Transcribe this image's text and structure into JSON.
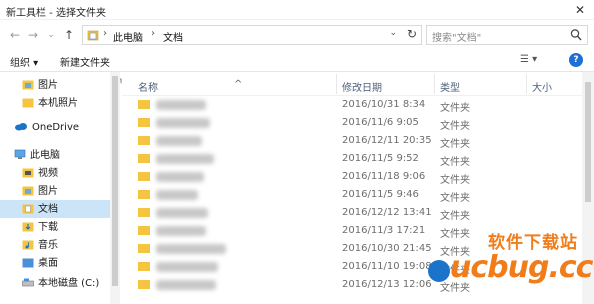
{
  "window": {
    "title": "新工具栏 - 选择文件夹",
    "close": "✕"
  },
  "address": {
    "crumbs": [
      "此电脑",
      "文档"
    ],
    "separator": "›",
    "dropdown": "⌄",
    "refresh": "↻"
  },
  "search": {
    "placeholder": "搜索\"文档\""
  },
  "nav_buttons": {
    "back": "←",
    "forward": "→",
    "dropdown": "⌄",
    "up": "↑"
  },
  "commands": {
    "organize": "组织 ▾",
    "new_folder": "新建文件夹",
    "view": "☰ ▾",
    "help": "?"
  },
  "sidebar": {
    "items": [
      {
        "label": "图片",
        "pinned": true,
        "icon": "pictures-folder-icon"
      },
      {
        "label": "本机照片",
        "icon": "folder-icon"
      },
      {
        "label": "OneDrive",
        "icon": "onedrive-cloud-icon"
      },
      {
        "label": "此电脑",
        "icon": "computer-icon"
      },
      {
        "label": "视频",
        "icon": "videos-folder-icon"
      },
      {
        "label": "图片",
        "icon": "pictures-folder-icon"
      },
      {
        "label": "文档",
        "icon": "documents-folder-icon",
        "selected": true
      },
      {
        "label": "下载",
        "icon": "downloads-folder-icon"
      },
      {
        "label": "音乐",
        "icon": "music-folder-icon"
      },
      {
        "label": "桌面",
        "icon": "desktop-folder-icon"
      },
      {
        "label": "本地磁盘 (C:)",
        "icon": "drive-icon"
      }
    ],
    "pin_glyph": "📌"
  },
  "columns": {
    "name": "名称",
    "modified": "修改日期",
    "type": "类型",
    "size": "大小",
    "sort_glyph": "^"
  },
  "files": [
    {
      "date": "2016/10/31 8:34",
      "type": "文件夹"
    },
    {
      "date": "2016/11/6 9:05",
      "type": "文件夹"
    },
    {
      "date": "2016/12/11 20:35",
      "type": "文件夹"
    },
    {
      "date": "2016/11/5 9:52",
      "type": "文件夹"
    },
    {
      "date": "2016/11/18 9:06",
      "type": "文件夹"
    },
    {
      "date": "2016/11/5 9:46",
      "type": "文件夹"
    },
    {
      "date": "2016/12/12 13:41",
      "type": "文件夹"
    },
    {
      "date": "2016/11/3 17:21",
      "type": "文件夹"
    },
    {
      "date": "2016/10/30 21:45",
      "type": "文件夹"
    },
    {
      "date": "2016/11/10 19:08",
      "type": "文件夹"
    },
    {
      "date": "2016/12/13 12:06",
      "type": "文件夹"
    }
  ],
  "watermark": {
    "chinese": "软件下载站",
    "latin": "ucbug.cc"
  },
  "colors": {
    "accent": "#1f6fd6",
    "folder": "#f5c542",
    "selection": "#cce4f7",
    "watermark": "#f07c1a"
  }
}
